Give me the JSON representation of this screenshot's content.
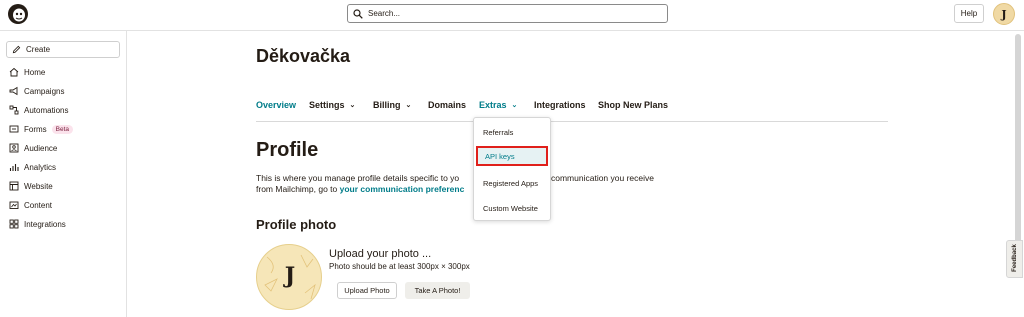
{
  "topbar": {
    "search_placeholder": "Search...",
    "help_label": "Help",
    "avatar_initial": "J"
  },
  "sidebar": {
    "create_label": "Create",
    "items": [
      {
        "label": "Home",
        "icon": "home-icon"
      },
      {
        "label": "Campaigns",
        "icon": "campaigns-icon"
      },
      {
        "label": "Automations",
        "icon": "automations-icon"
      },
      {
        "label": "Forms",
        "icon": "forms-icon",
        "badge": "Beta"
      },
      {
        "label": "Audience",
        "icon": "audience-icon"
      },
      {
        "label": "Analytics",
        "icon": "analytics-icon"
      },
      {
        "label": "Website",
        "icon": "website-icon"
      },
      {
        "label": "Content",
        "icon": "content-icon"
      },
      {
        "label": "Integrations",
        "icon": "integrations-icon"
      }
    ]
  },
  "main": {
    "org_title": "Děkovačka",
    "tabs": [
      {
        "label": "Overview",
        "active": true
      },
      {
        "label": "Settings"
      },
      {
        "label": "Billing"
      },
      {
        "label": "Domains"
      },
      {
        "label": "Extras"
      },
      {
        "label": "Integrations"
      },
      {
        "label": "Shop New Plans"
      }
    ],
    "profile_heading": "Profile",
    "desc_part1": "This is where you manage profile details specific to yo",
    "desc_part2": "communication you receive",
    "desc_line2_prefix": "from Mailchimp, go to ",
    "desc_link": "your communication preferenc",
    "photo_heading": "Profile photo",
    "avatar_initial": "J",
    "upload_heading": "Upload your photo ...",
    "upload_sub": "Photo should be at least 300px × 300px",
    "upload_button": "Upload Photo",
    "take_button": "Take A Photo!"
  },
  "extras_menu": {
    "items": [
      "Referrals",
      "API keys",
      "Registered Apps",
      "Custom Website"
    ],
    "highlighted": "API keys"
  },
  "feedback_label": "Feedback",
  "colors": {
    "accent": "#007c89",
    "highlight_border": "#e0201b",
    "avatar_bg": "#f6e6b8"
  }
}
